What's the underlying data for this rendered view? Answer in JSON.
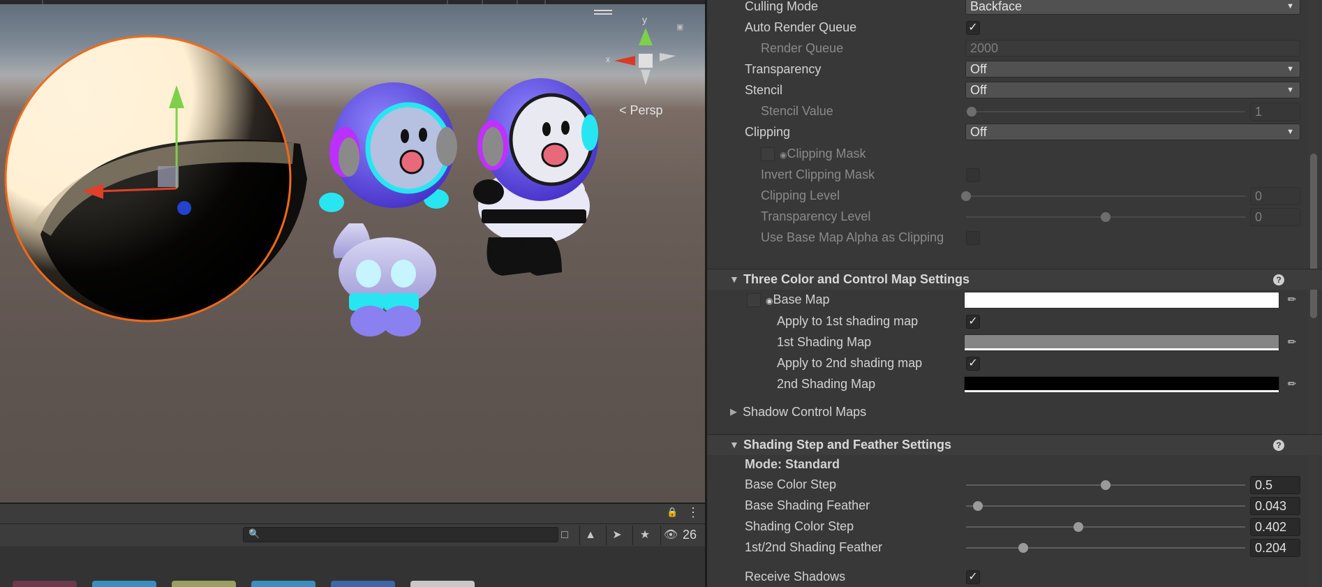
{
  "scene": {
    "view_mode": "Persp",
    "gizmo_axis_y": "y",
    "gizmo_axis_x": "x"
  },
  "project_bar": {
    "search": {
      "value": "",
      "placeholder": ""
    },
    "hidden_count": "26"
  },
  "inspector": {
    "culling_mode": {
      "label": "Culling Mode",
      "value": "Backface"
    },
    "auto_render_queue": {
      "label": "Auto Render Queue",
      "checked": true
    },
    "render_queue": {
      "label": "Render Queue",
      "value": "2000"
    },
    "transparency": {
      "label": "Transparency",
      "value": "Off"
    },
    "stencil": {
      "label": "Stencil",
      "value": "Off"
    },
    "stencil_value": {
      "label": "Stencil Value",
      "value": "1",
      "slider": 0.02
    },
    "clipping": {
      "label": "Clipping",
      "value": "Off"
    },
    "clipping_mask": {
      "label": "Clipping Mask"
    },
    "invert_clipping_mask": {
      "label": "Invert Clipping Mask",
      "checked": false
    },
    "clipping_level": {
      "label": "Clipping Level",
      "value": "0",
      "slider": 0.0
    },
    "transparency_level": {
      "label": "Transparency Level",
      "value": "0",
      "slider": 0.5
    },
    "use_base_map_alpha": {
      "label": "Use Base Map Alpha as Clipping",
      "checked": false
    },
    "three_color_section": {
      "title": "Three Color and Control Map Settings"
    },
    "base_map": {
      "label": "Base Map",
      "color": "#ffffff"
    },
    "apply_1st": {
      "label": "Apply to 1st shading map",
      "checked": true
    },
    "first_shading_map": {
      "label": "1st Shading Map",
      "color": "#858585"
    },
    "apply_2nd": {
      "label": "Apply to 2nd shading map",
      "checked": true
    },
    "second_shading_map": {
      "label": "2nd Shading Map",
      "color": "#000000"
    },
    "shadow_control_maps": {
      "title": "Shadow Control Maps"
    },
    "shading_step_section": {
      "title": "Shading Step and Feather Settings"
    },
    "mode": {
      "label": "Mode: Standard"
    },
    "base_color_step": {
      "label": "Base Color Step",
      "value": "0.5",
      "slider": 0.5
    },
    "base_shading_feather": {
      "label": "Base Shading Feather",
      "value": "0.043",
      "slider": 0.043
    },
    "shading_color_step": {
      "label": "Shading Color Step",
      "value": "0.402",
      "slider": 0.402
    },
    "shading_feather_12": {
      "label": "1st/2nd Shading Feather",
      "value": "0.204",
      "slider": 0.204
    },
    "receive_shadows": {
      "label": "Receive Shadows",
      "checked": true
    }
  }
}
